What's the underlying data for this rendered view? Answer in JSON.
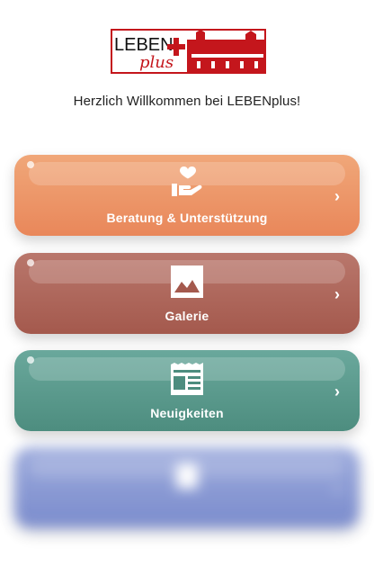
{
  "logo": {
    "word1": "LEBEN",
    "word2": "plus"
  },
  "welcome": "Herzlich Willkommen bei LEBENplus!",
  "menu": [
    {
      "label": "Beratung & Unterstützung",
      "icon": "hand-heart-icon",
      "color": "#e9875a"
    },
    {
      "label": "Galerie",
      "icon": "image-icon",
      "color": "#a4594d"
    },
    {
      "label": "Neuigkeiten",
      "icon": "newspaper-icon",
      "color": "#4d8d7f"
    },
    {
      "label": "",
      "icon": "blurred-icon",
      "color": "#6478c4"
    }
  ],
  "chevron": "›"
}
